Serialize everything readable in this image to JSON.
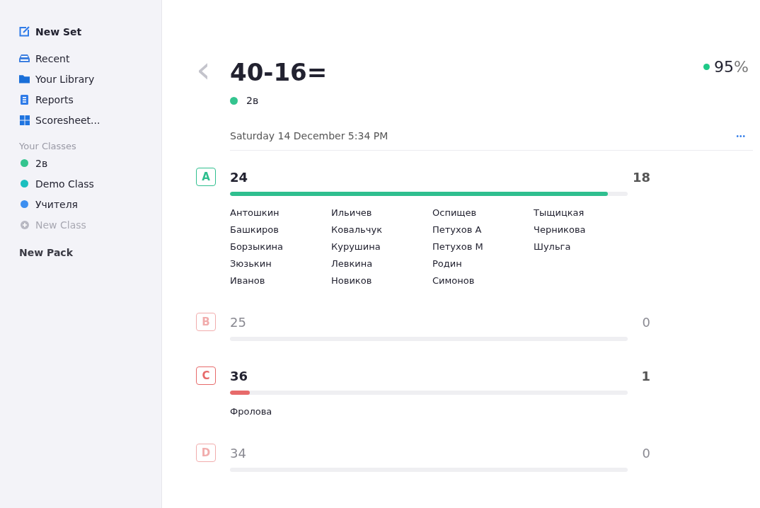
{
  "sidebar": {
    "actions": [
      {
        "label": "New Set"
      }
    ],
    "nav": [
      {
        "label": "Recent"
      },
      {
        "label": "Your Library"
      },
      {
        "label": "Reports"
      },
      {
        "label": "Scoresheet..."
      }
    ],
    "classes_heading": "Your Classes",
    "classes": [
      {
        "label": "2в",
        "color": "#34c48f"
      },
      {
        "label": "Demo Class",
        "color": "#1bbfbf"
      },
      {
        "label": "Учителя",
        "color": "#3d8ff0"
      }
    ],
    "new_class": {
      "label": "New Class",
      "disabled": true
    },
    "new_pack": "New Pack"
  },
  "question": {
    "back": "‹",
    "title": "40-16=",
    "class": {
      "label": "2в",
      "color": "#34c48f"
    },
    "score": "95",
    "score_unit": "%",
    "date": "Saturday 14 December 5:34 PM",
    "more": "•••"
  },
  "answers": [
    {
      "letter": "A",
      "value": "24",
      "count": "18",
      "correct": true,
      "dimmed": false,
      "level": 0.95,
      "names": [
        "Антошкин",
        "Башкиров",
        "Борзыкина",
        "Зюзькин",
        "Иванов",
        "Ильичев",
        "Ковальчук",
        "Курушина",
        "Левкина",
        "Новиков",
        "Оспищев",
        "Петухов А",
        "Петухов М",
        "Родин",
        "Симонов",
        "Тыщицкая",
        "Черникова",
        "Шульга"
      ]
    },
    {
      "letter": "B",
      "value": "25",
      "count": "0",
      "correct": false,
      "dimmed": true,
      "level": 0
    },
    {
      "letter": "C",
      "value": "36",
      "count": "1",
      "correct": false,
      "dimmed": false,
      "level": 0.05,
      "names": [
        "Фролова"
      ]
    },
    {
      "letter": "D",
      "value": "34",
      "count": "0",
      "correct": false,
      "dimmed": true,
      "level": 0
    }
  ]
}
